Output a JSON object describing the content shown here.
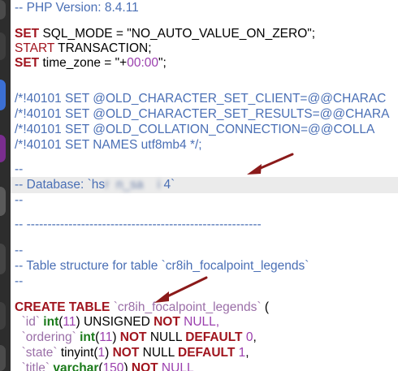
{
  "lines": {
    "php_version": "-- PHP Version: 8.4.11",
    "set_kw1": "SET",
    "sql_mode_rest": " SQL_MODE = \"NO_AUTO_VALUE_ON_ZERO\";",
    "start_kw": "START",
    "transaction_rest": " TRANSACTION;",
    "set_kw2": "SET",
    "tz_rest_a": " time_zone = \"+",
    "tz_num": "00:00",
    "tz_rest_b": "\";",
    "cs_client": "/*!40101 SET @OLD_CHARACTER_SET_CLIENT=@@CHARAC",
    "cs_results": "/*!40101 SET @OLD_CHARACTER_SET_RESULTS=@@CHARA",
    "coll_conn": "/*!40101 SET @OLD_COLLATION_CONNECTION=@@COLLA",
    "set_names": "/*!40101 SET NAMES utf8mb4 */;",
    "dashes1": "--",
    "database_prefix": "-- Database: `hs",
    "database_blur1": "r  n_sa  ",
    "database_blur2": "  i ",
    "database_suffix": "4`",
    "dashes2": "--",
    "separator": "-- --------------------------------------------------------",
    "dashes3": "--",
    "table_structure": "-- Table structure for table `cr8ih_focalpoint_legends`",
    "dashes4": "--",
    "create_kw": "CREATE TABLE",
    "create_table_name": " `cr8ih_focalpoint_legends`",
    "create_paren": " (",
    "id_col": "  `id`",
    "id_type": " int",
    "id_paren_a": "(",
    "id_num": "11",
    "id_paren_b": ") UNSIGNED ",
    "id_not": "NOT",
    "id_null": " NULL,",
    "ord_col": "  `ordering`",
    "ord_type": " int",
    "ord_paren_a": "(",
    "ord_num": "11",
    "ord_paren_b": ") ",
    "ord_not": "NOT",
    "ord_null": " NULL ",
    "ord_default": "DEFAULT",
    "ord_val": " 0",
    "ord_comma": ",",
    "state_col": "  `state`",
    "state_type": " tinyint(",
    "state_num": "1",
    "state_paren_b": ") ",
    "state_not": "NOT",
    "state_null": " NULL ",
    "state_default": "DEFAULT",
    "state_val": " 1",
    "state_comma": ",",
    "title_col": "  `title`",
    "title_type": " varchar",
    "title_paren_a": "(",
    "title_num": "150",
    "title_paren_b": ") ",
    "title_not": "NOT",
    "title_null": " NULL"
  },
  "colors": {
    "comment": "#4a6fb5",
    "keyword": "#a0141e",
    "number": "#9b3fae",
    "type": "#1a7a1a",
    "arrow": "#8b1a1a",
    "highlight_line": "#ebebeb"
  },
  "icons": [
    "app-dock-icon",
    "annotation-arrow-icon"
  ]
}
